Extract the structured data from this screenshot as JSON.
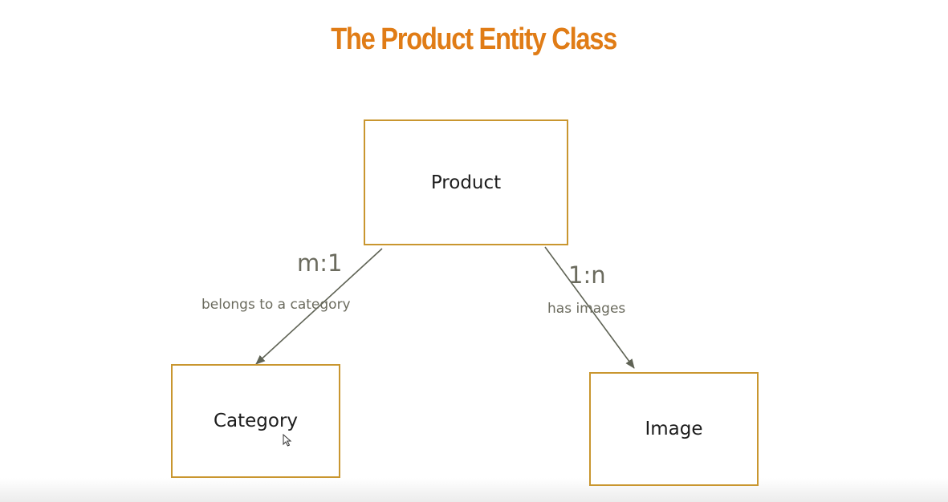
{
  "title": "The Product Entity Class",
  "colors": {
    "title": "#e07c16",
    "box_border": "#c9962f",
    "connector": "#5f6355",
    "annotation_text": "#6b6b5e"
  },
  "entities": {
    "product": "Product",
    "category": "Category",
    "image": "Image"
  },
  "relationships": [
    {
      "from": "Product",
      "to": "Category",
      "multiplicity": "m:1",
      "label": "belongs to a category"
    },
    {
      "from": "Product",
      "to": "Image",
      "multiplicity": "1:n",
      "label": "has images"
    }
  ],
  "cursor_icon": "mouse-pointer-icon"
}
